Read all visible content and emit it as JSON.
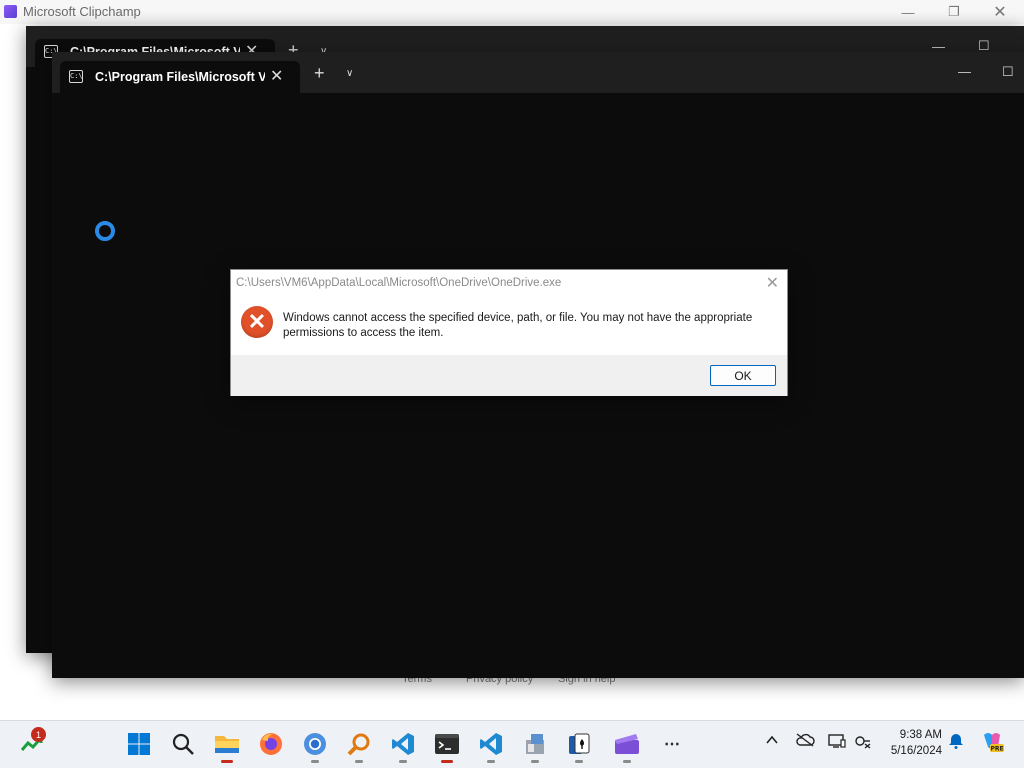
{
  "clipchamp": {
    "title": "Microsoft Clipchamp",
    "footer_links": [
      "Terms",
      "Privacy policy",
      "Sign in help"
    ]
  },
  "terminal_back": {
    "tab_title": "C:\\Program Files\\Microsoft Vi"
  },
  "terminal_front": {
    "tab_title": "C:\\Program Files\\Microsoft Vi"
  },
  "dialog": {
    "title": "C:\\Users\\VM6\\AppData\\Local\\Microsoft\\OneDrive\\OneDrive.exe",
    "message": "Windows cannot access the specified device, path, or file. You may not have the appropriate permissions to access the item.",
    "ok_label": "OK",
    "icon": "error-icon"
  },
  "taskbar": {
    "widgets_badge": "1",
    "apps": [
      {
        "name": "start",
        "icon": "windows-start-icon"
      },
      {
        "name": "search",
        "icon": "search-icon"
      },
      {
        "name": "file-explorer",
        "icon": "folder-icon"
      },
      {
        "name": "firefox",
        "icon": "firefox-icon"
      },
      {
        "name": "chrome",
        "icon": "chrome-icon"
      },
      {
        "name": "search-tool",
        "icon": "magnifier-app-icon"
      },
      {
        "name": "vscode",
        "icon": "vscode-icon"
      },
      {
        "name": "terminal",
        "icon": "terminal-icon"
      },
      {
        "name": "vscode-2",
        "icon": "vscode-icon"
      },
      {
        "name": "app",
        "icon": "app-icon"
      },
      {
        "name": "solitaire",
        "icon": "cards-icon"
      },
      {
        "name": "clipchamp",
        "icon": "clipchamp-icon"
      },
      {
        "name": "more",
        "icon": "ellipsis-icon"
      }
    ],
    "tray": {
      "time": "9:38 AM",
      "date": "5/16/2024"
    }
  },
  "colors": {
    "terminal_bg": "#0c0c0c",
    "error_icon": "#e0512a",
    "accent": "#0067c0",
    "spinner": "#2b8ae6"
  }
}
